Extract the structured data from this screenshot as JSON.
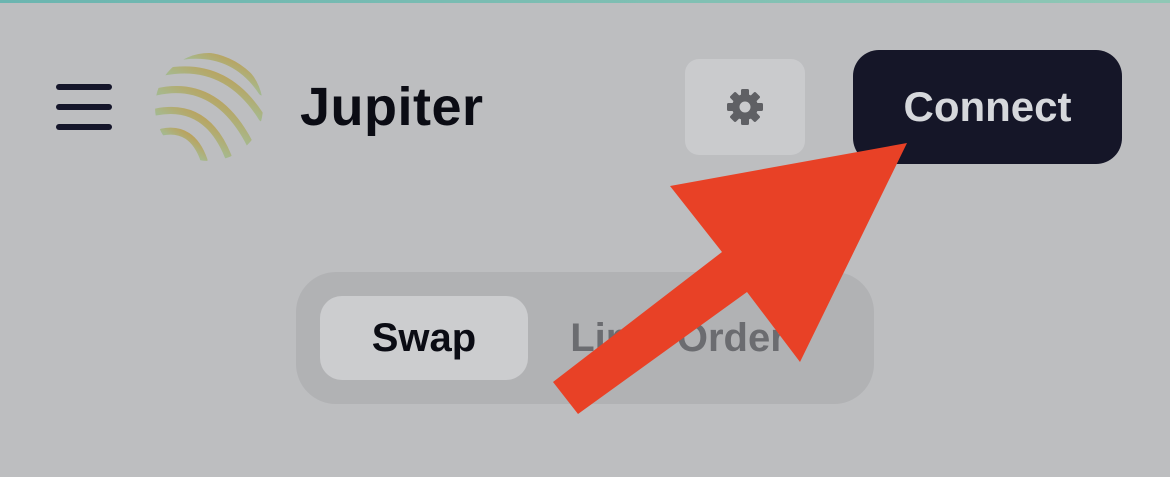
{
  "header": {
    "brand": "Jupiter",
    "connect_label": "Connect",
    "menu_icon": "hamburger-menu-icon",
    "settings_icon": "gear-icon",
    "logo_icon": "jupiter-logo"
  },
  "tabs": [
    {
      "label": "Swap",
      "active": true
    },
    {
      "label": "Limit Order",
      "active": false
    }
  ],
  "annotation": {
    "type": "red-arrow",
    "color": "#e84126",
    "points_to": "connect-button"
  },
  "colors": {
    "background": "#bdbec0",
    "connect_button": "#151628",
    "arrow": "#e84126"
  }
}
